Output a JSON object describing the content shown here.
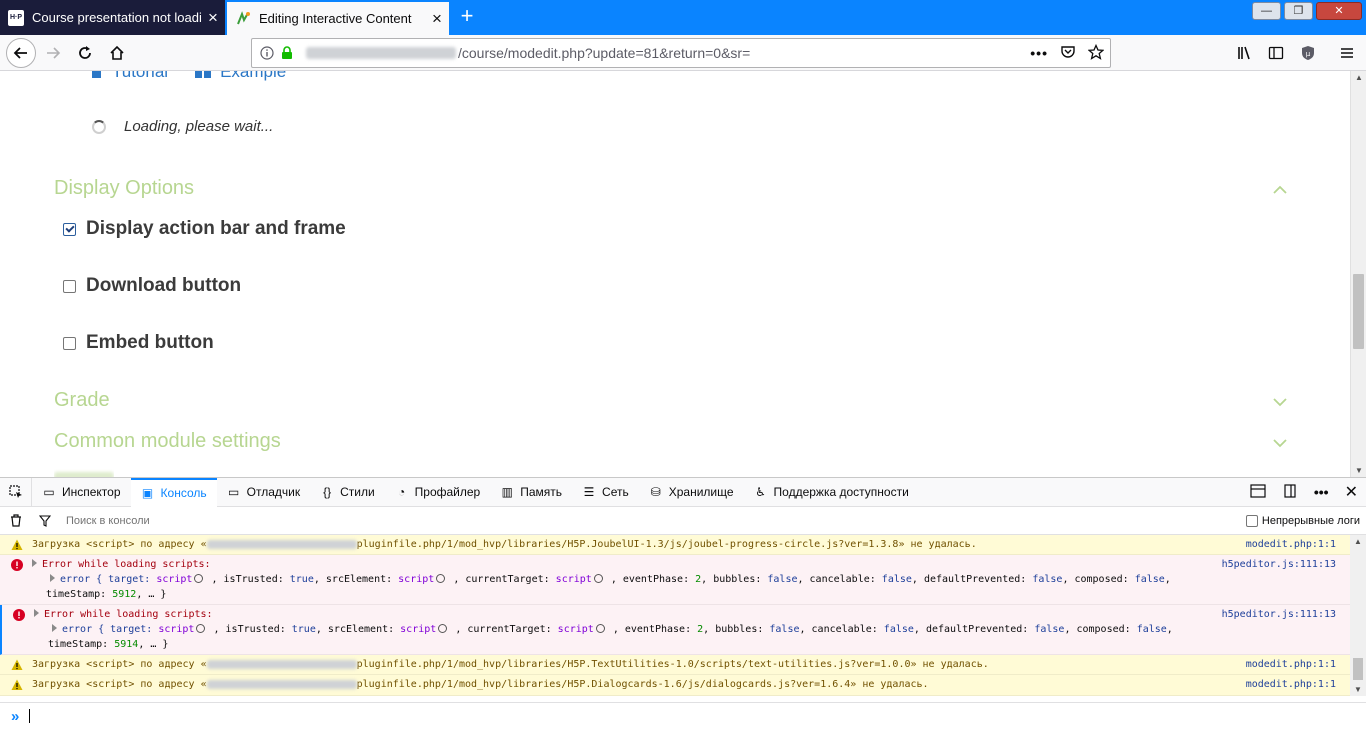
{
  "browser": {
    "tabs": [
      {
        "title": "Course presentation not loadin",
        "favicon": "h5p-logo-icon",
        "favicon_text": "H·P"
      },
      {
        "title": "Editing Interactive Content",
        "favicon": "moodle-icon"
      }
    ],
    "new_tab_symbol": "+",
    "url_path": "/course/modedit.php?update=81&return=0&sr="
  },
  "page": {
    "help_links": {
      "tutorial": "Tutorial",
      "example": "Example"
    },
    "loading_text": "Loading, please wait...",
    "display_options": {
      "title": "Display Options",
      "options": [
        {
          "label": "Display action bar and frame",
          "checked": true
        },
        {
          "label": "Download button",
          "checked": false
        },
        {
          "label": "Embed button",
          "checked": false
        }
      ]
    },
    "sections": {
      "grade": "Grade",
      "common_module": "Common module settings"
    },
    "colors": {
      "section": "#b7d691",
      "link": "#2b77c6"
    }
  },
  "devtools": {
    "tabs": {
      "inspector": "Инспектор",
      "console": "Консоль",
      "debugger": "Отладчик",
      "styles": "Стили",
      "profiler": "Профайлер",
      "memory": "Память",
      "network": "Сеть",
      "storage": "Хранилище",
      "accessibility": "Поддержка доступности"
    },
    "filter_placeholder": "Поиск в консоли",
    "persist_logs": "Непрерывные логи",
    "messages": [
      {
        "kind": "warn",
        "prefix": "Загрузка <script> по адресу «",
        "path": "pluginfile.php/1/mod_hvp/libraries/H5P.JoubelUI-1.3/js/joubel-progress-circle.js?ver=1.3.8» не удалась.",
        "source": "modedit.php:1:1"
      },
      {
        "kind": "error",
        "title": "Error while loading scripts:",
        "timestamp": "5912",
        "source": "h5peditor.js:111:13"
      },
      {
        "kind": "error",
        "title": "Error while loading scripts:",
        "timestamp": "5914",
        "source": "h5peditor.js:111:13"
      },
      {
        "kind": "warn",
        "prefix": "Загрузка <script> по адресу «",
        "path": "pluginfile.php/1/mod_hvp/libraries/H5P.TextUtilities-1.0/scripts/text-utilities.js?ver=1.0.0» не удалась.",
        "source": "modedit.php:1:1"
      },
      {
        "kind": "warn",
        "prefix": "Загрузка <script> по адресу «",
        "path": "pluginfile.php/1/mod_hvp/libraries/H5P.Dialogcards-1.6/js/dialogcards.js?ver=1.6.4» не удалась.",
        "source": "modedit.php:1:1"
      }
    ],
    "error_detail": {
      "open": "error { target: ",
      "script": "script",
      "is_trusted": ", isTrusted: ",
      "true": "true",
      "src_element": ", srcElement: ",
      "current_target": ", currentTarget: ",
      "event_phase": ", eventPhase: ",
      "phase": "2",
      "bubbles": ", bubbles: ",
      "false": "false",
      "cancelable": ", cancelable: ",
      "default_prevented": ", defaultPrevented: ",
      "composed": ", composed: ",
      "trail": ",",
      "timestamp_key": "timeStamp: ",
      "close": ", … }"
    },
    "prompt_symbol": "»"
  }
}
